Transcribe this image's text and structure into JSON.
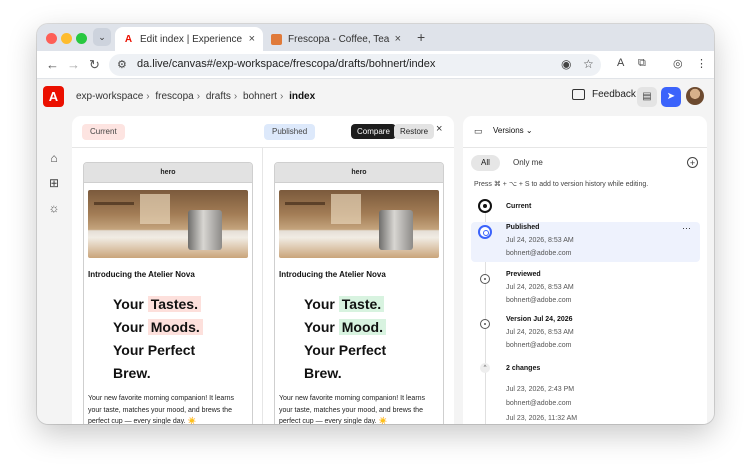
{
  "browser": {
    "tabs": [
      {
        "title": "Edit index | Experience Workspace",
        "active": true
      },
      {
        "title": "Frescopa - Coffee, Tea & Accessories",
        "active": false
      }
    ],
    "url": "da.live/canvas#/exp-workspace/frescopa/drafts/bohnert/index",
    "new_tab_icon": "+",
    "close_icon": "×"
  },
  "header": {
    "logo_text": "A",
    "breadcrumb": [
      "exp-workspace",
      "frescopa",
      "drafts",
      "bohnert",
      "index"
    ],
    "feedback_label": "Feedback"
  },
  "compare": {
    "current_label": "Current",
    "published_label": "Published",
    "compare_button": "Compare",
    "restore_button": "Restore",
    "left": {
      "block_name": "hero",
      "heading": "Introducing the Atelier Nova",
      "lines": [
        {
          "plain": "Your",
          "hl": "Tastes."
        },
        {
          "plain": "Your",
          "hl": "Moods."
        },
        {
          "plain": "Your Perfect",
          "hl": ""
        },
        {
          "plain": "Brew.",
          "hl": ""
        }
      ],
      "paragraph": "Your new favorite morning companion! It learns your taste, matches your mood, and brews the perfect cup — every single day. ☀️"
    },
    "right": {
      "block_name": "hero",
      "heading": "Introducing the Atelier Nova",
      "lines": [
        {
          "plain": "Your",
          "hl": "Taste."
        },
        {
          "plain": "Your",
          "hl": "Mood."
        },
        {
          "plain": "Your Perfect",
          "hl": ""
        },
        {
          "plain": "Brew.",
          "hl": ""
        }
      ],
      "paragraph": "Your new favorite morning companion! It learns your taste, matches your mood, and brews the perfect cup — every single day. ☀️"
    }
  },
  "versions": {
    "title": "Versions",
    "filters": {
      "all": "All",
      "mine": "Only me"
    },
    "hint": "Press ⌘ + ⌥ + S to add to version history while editing.",
    "entries": [
      {
        "name": "Current",
        "date": "",
        "author": ""
      },
      {
        "name": "Published",
        "date": "Jul 24, 2026, 8:53 AM",
        "author": "bohnert@adobe.com"
      },
      {
        "name": "Previewed",
        "date": "Jul 24, 2026, 8:53 AM",
        "author": "bohnert@adobe.com"
      },
      {
        "name": "Version Jul 24, 2026",
        "date": "Jul 24, 2026, 8:53 AM",
        "author": "bohnert@adobe.com"
      },
      {
        "name": "2 changes",
        "date": "Jul 23, 2026, 2:43 PM",
        "author": "bohnert@adobe.com"
      },
      {
        "name": "",
        "date": "Jul 23, 2026, 11:32 AM",
        "author": ""
      }
    ]
  }
}
